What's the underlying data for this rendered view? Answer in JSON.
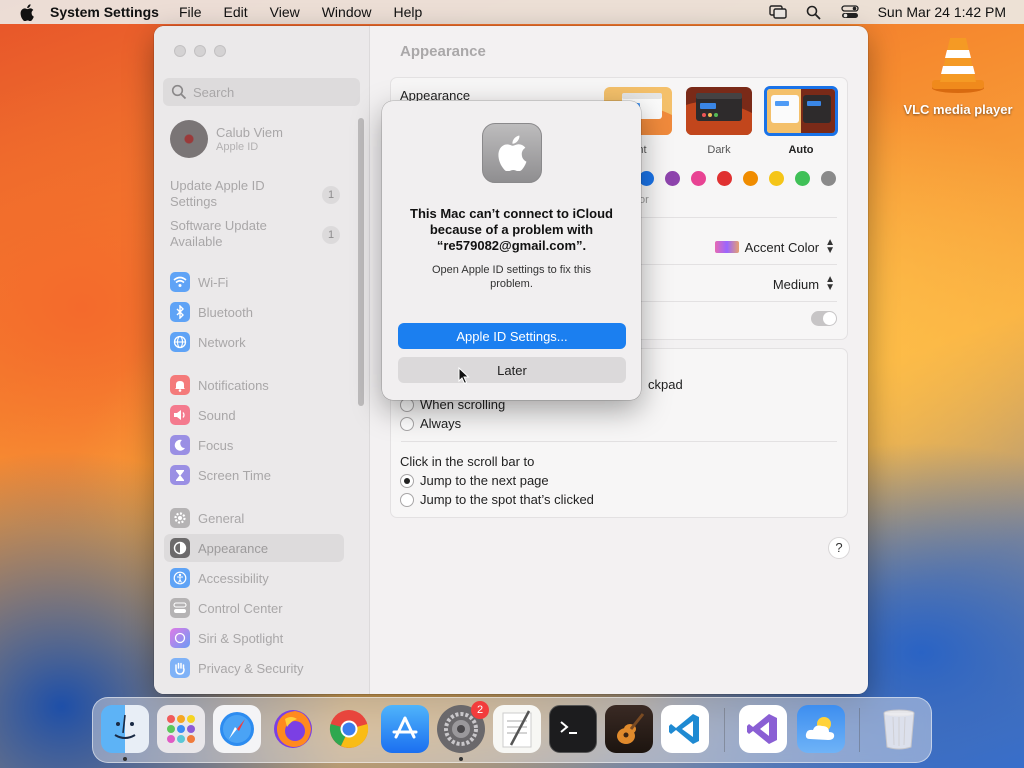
{
  "menubar": {
    "app_name": "System Settings",
    "items": [
      "File",
      "Edit",
      "View",
      "Window",
      "Help"
    ],
    "clock": "Sun Mar 24  1:42 PM"
  },
  "desktop": {
    "vlc_label": "VLC media player"
  },
  "sidebar": {
    "search_placeholder": "Search",
    "account": {
      "name": "Calub Viem",
      "sub": "Apple ID"
    },
    "notices": [
      {
        "label": "Update Apple ID Settings",
        "badge": "1"
      },
      {
        "label": "Software Update Available",
        "badge": "1"
      }
    ],
    "items": [
      {
        "label": "Wi-Fi",
        "color": "#3b8df5"
      },
      {
        "label": "Bluetooth",
        "color": "#3b8df5"
      },
      {
        "label": "Network",
        "color": "#3b8df5"
      },
      {
        "label": "Notifications",
        "color": "#f04a4a"
      },
      {
        "label": "Sound",
        "color": "#f04a6a"
      },
      {
        "label": "Focus",
        "color": "#6a5bd6"
      },
      {
        "label": "Screen Time",
        "color": "#6a5bd6"
      },
      {
        "label": "General",
        "color": "#9a9a9a"
      },
      {
        "label": "Appearance",
        "color": "#222222"
      },
      {
        "label": "Accessibility",
        "color": "#3b8df5"
      },
      {
        "label": "Control Center",
        "color": "#9a9a9a"
      },
      {
        "label": "Siri & Spotlight",
        "color": "#c653d6"
      },
      {
        "label": "Privacy & Security",
        "color": "#3b8df5"
      }
    ]
  },
  "content": {
    "title": "Appearance",
    "appearance_label": "Appearance",
    "modes": [
      "ht",
      "Dark",
      "Auto"
    ],
    "accent_color_label": "Accent Color",
    "accent_partial": "or",
    "accent_colors": [
      "#1a73e8",
      "#8e44ad",
      "#e84393",
      "#e03131",
      "#f08c00",
      "#f5c518",
      "#40c057",
      "#8a8a8a"
    ],
    "sidebar_icon_size": "Medium",
    "scroll_partial": "ckpad",
    "scroll_options": [
      "When scrolling",
      "Always"
    ],
    "click_label": "Click in the scroll bar to",
    "click_options": [
      "Jump to the next page",
      "Jump to the spot that’s clicked"
    ],
    "help": "?"
  },
  "alert": {
    "headline": "This Mac can’t connect to iCloud because of a problem with “re579082@gmail.com”.",
    "message": "Open Apple ID settings to fix this problem.",
    "primary": "Apple ID Settings...",
    "secondary": "Later"
  },
  "dock": {
    "settings_badge": "2",
    "apps": [
      "finder-icon",
      "launchpad-icon",
      "safari-icon",
      "firefox-icon",
      "chrome-icon",
      "app-store-icon",
      "system-settings-icon",
      "textedit-icon",
      "terminal-icon",
      "garageband-icon",
      "vscode-icon",
      "visual-studio-icon",
      "weather-icon",
      "trash-icon"
    ]
  }
}
